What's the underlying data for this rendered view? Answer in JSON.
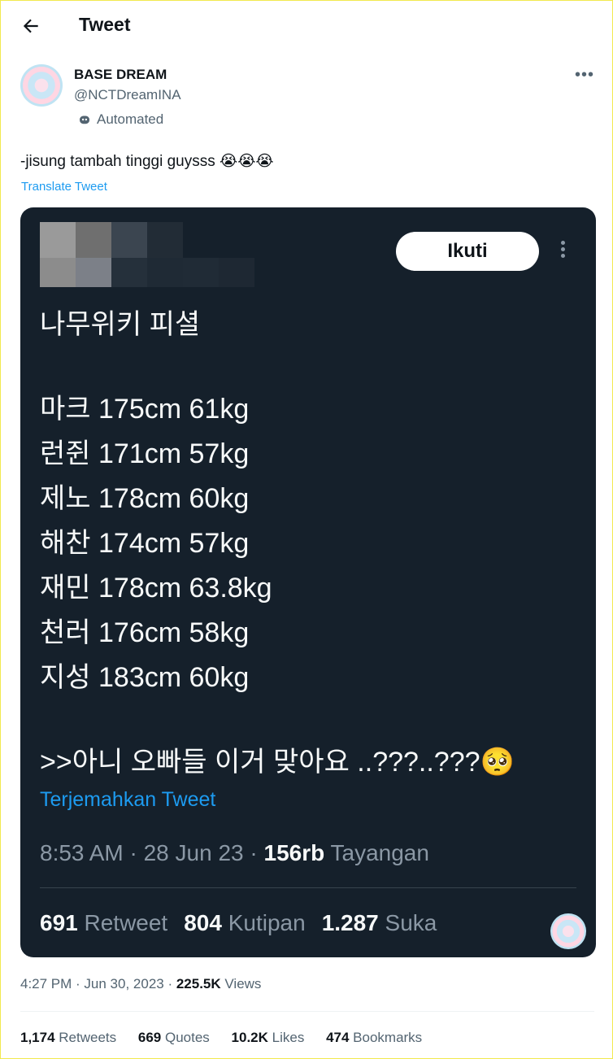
{
  "header": {
    "title": "Tweet",
    "back_icon": "arrow-left-icon"
  },
  "author": {
    "name": "BASE DREAM",
    "handle": "@NCTDreamINA",
    "automated_label": "Automated"
  },
  "tweet": {
    "text": "-jisung tambah tinggi guysss 😭😭😭",
    "translate_label": "Translate Tweet"
  },
  "embedded": {
    "follow_label": "Ikuti",
    "lines": [
      "나무위키 피셜",
      "마크 175cm 61kg",
      "런쥔 171cm 57kg",
      "제노 178cm 60kg",
      "해찬 174cm 57kg",
      "재민 178cm 63.8kg",
      "천러 176cm 58kg",
      "지성 183cm 60kg",
      ">>아니 오빠들 이거 맞아요 ..???..???🥺"
    ],
    "translate_label": "Terjemahkan Tweet",
    "time": "8:53 AM · 28 Jun 23 · ",
    "views_count": "156rb",
    "views_label": " Tayangan",
    "retweets_count": "691",
    "retweets_label": " Retweet",
    "quotes_count": "804",
    "quotes_label": " Kutipan",
    "likes_count": "1.287",
    "likes_label": " Suka"
  },
  "meta": {
    "timestamp": "4:27 PM · Jun 30, 2023 · ",
    "views_count": "225.5K",
    "views_label": " Views"
  },
  "stats": {
    "retweets_count": "1,174",
    "retweets_label": " Retweets",
    "quotes_count": "669",
    "quotes_label": " Quotes",
    "likes_count": "10.2K",
    "likes_label": " Likes",
    "bookmarks_count": "474",
    "bookmarks_label": " Bookmarks"
  },
  "colors": {
    "accent": "#1d9bf0",
    "embed_bg": "#15202b",
    "muted": "#536471"
  }
}
